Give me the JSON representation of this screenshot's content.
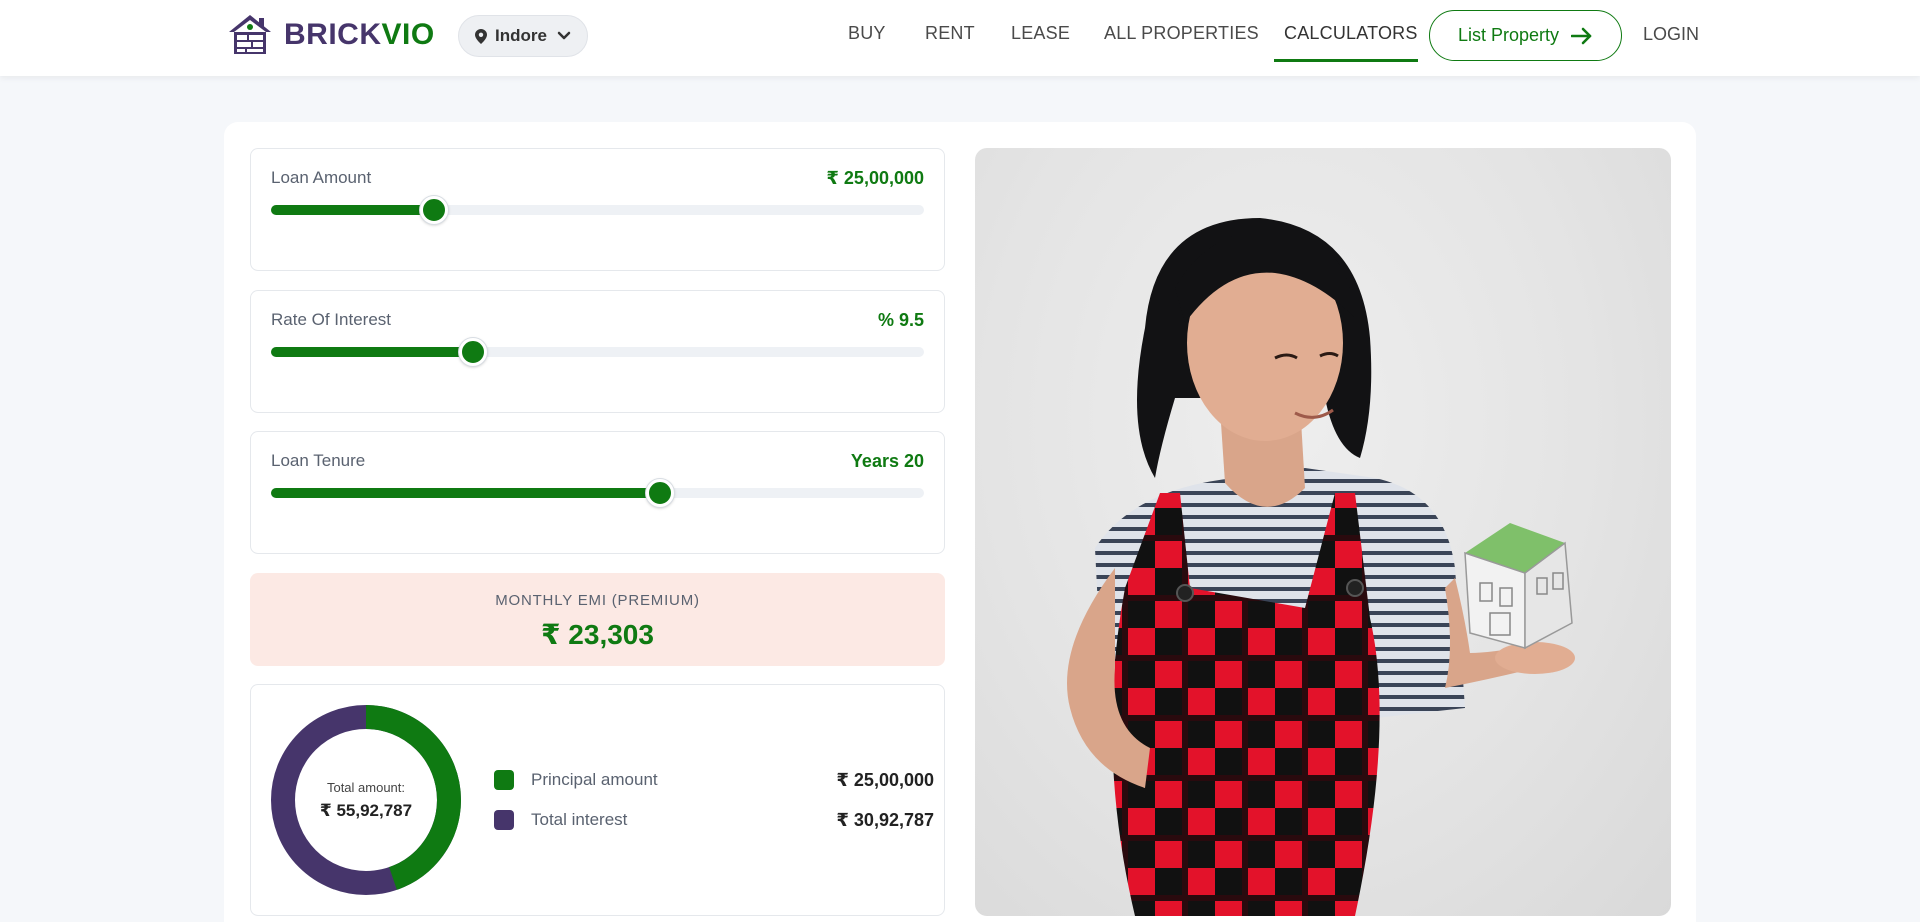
{
  "brand": {
    "part1": "BRICK",
    "part2": "VIO"
  },
  "city": {
    "selected": "Indore"
  },
  "nav": {
    "items": [
      "BUY",
      "RENT",
      "LEASE",
      "ALL PROPERTIES",
      "CALCULATORS"
    ],
    "active": "CALCULATORS",
    "list_property": "List Property",
    "login": "LOGIN"
  },
  "calculator": {
    "sliders": [
      {
        "label": "Loan Amount",
        "value": "₹ 25,00,000",
        "fraction": 0.25
      },
      {
        "label": "Rate Of Interest",
        "value": "% 9.5",
        "fraction": 0.31
      },
      {
        "label": "Loan Tenure",
        "value": "Years 20",
        "fraction": 0.595
      }
    ],
    "emi": {
      "label": "MONTHLY EMI (PREMIUM)",
      "value": "₹ 23,303"
    },
    "breakdown": {
      "total_label": "Total amount:",
      "total_value": "₹ 55,92,787",
      "principal": {
        "label": "Principal amount",
        "value": "₹ 25,00,000",
        "color": "#0f7a12",
        "fraction": 0.447
      },
      "interest": {
        "label": "Total interest",
        "value": "₹ 30,92,787",
        "color": "#46356b",
        "fraction": 0.553
      }
    }
  },
  "colors": {
    "accent": "#0f7a12",
    "brand_purple": "#46356b",
    "emi_bg": "#fce9e4"
  }
}
